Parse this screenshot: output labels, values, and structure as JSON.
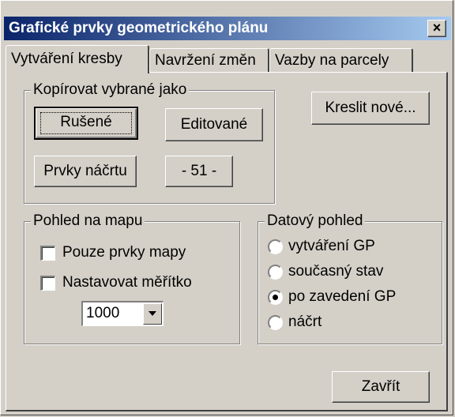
{
  "window": {
    "title": "Grafické prvky geometrického plánu",
    "close_label": "×"
  },
  "tabs": [
    "Vytváření kresby",
    "Navržení změn",
    "Vazby na parcely"
  ],
  "copy_group": {
    "label": "Kopírovat vybrané jako",
    "rusene": "Rušené",
    "editovane": "Editované",
    "prvky_nacrtu": "Prvky náčrtu",
    "num": "- 51 -"
  },
  "kreslit_nove": "Kreslit nové...",
  "map_group": {
    "label": "Pohled na mapu",
    "only_map": "Pouze prvky mapy",
    "set_scale": "Nastavovat měřítko",
    "scale_value": "1000"
  },
  "data_view": {
    "label": "Datový pohled",
    "options": [
      "vytváření GP",
      "současný stav",
      "po zavedení GP",
      "náčrt"
    ],
    "selected_index": 2
  },
  "close_button": "Zavřít",
  "colors": {
    "face": "#d4d0c8",
    "title_start": "#0a246a",
    "title_end": "#a6caf0"
  }
}
